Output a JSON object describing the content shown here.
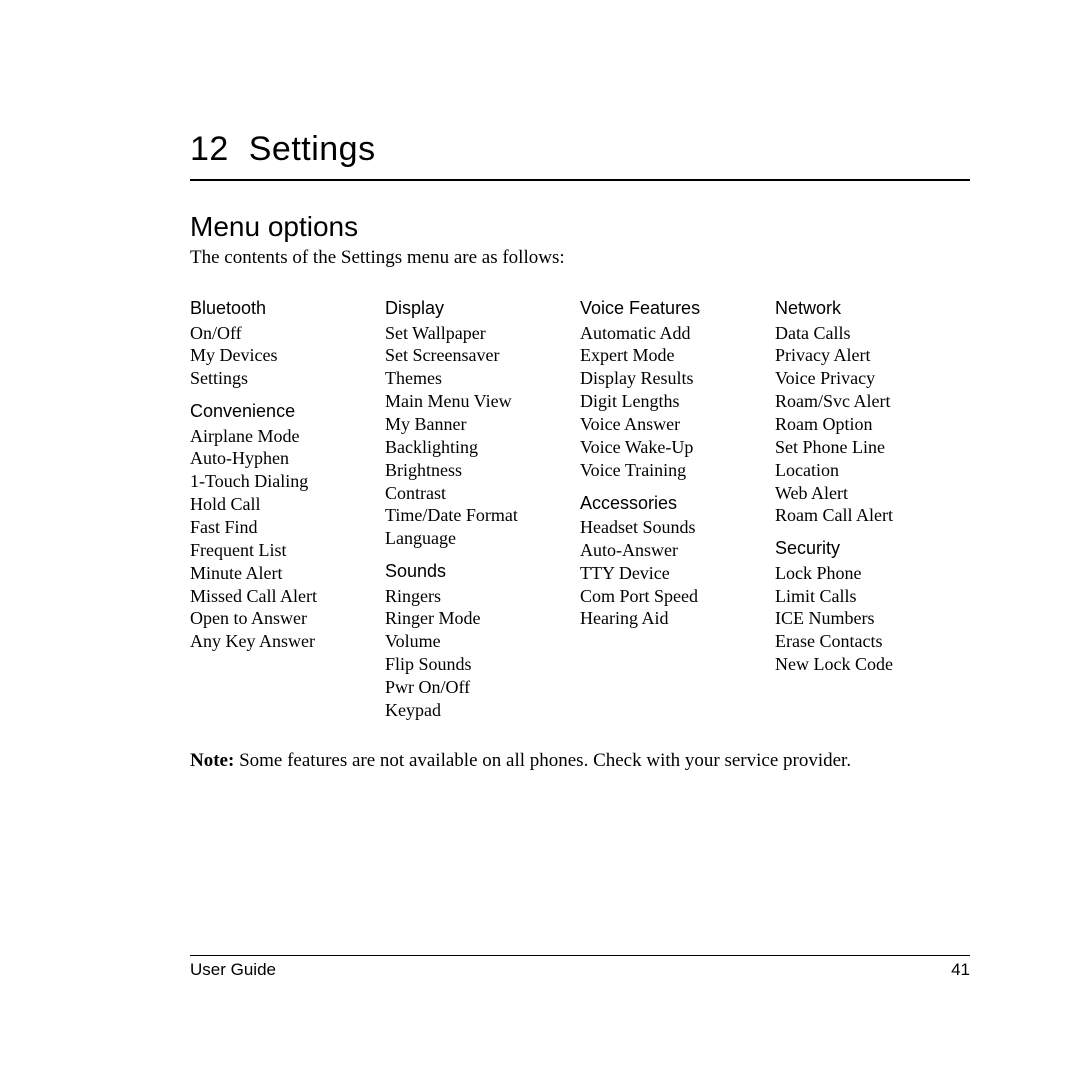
{
  "chapter": {
    "number": "12",
    "title": "Settings"
  },
  "section": {
    "heading": "Menu options",
    "intro": "The contents of the Settings menu are as follows:"
  },
  "columns": [
    {
      "groups": [
        {
          "heading": "Bluetooth",
          "items": [
            "On/Off",
            "My Devices",
            "Settings"
          ]
        },
        {
          "heading": "Convenience",
          "items": [
            "Airplane Mode",
            "Auto-Hyphen",
            "1-Touch Dialing",
            "Hold Call",
            "Fast Find",
            "Frequent List",
            "Minute Alert",
            "Missed Call Alert",
            "Open to Answer",
            "Any Key Answer"
          ]
        }
      ]
    },
    {
      "groups": [
        {
          "heading": "Display",
          "items": [
            "Set Wallpaper",
            "Set Screensaver",
            "Themes",
            "Main Menu View",
            "My Banner",
            "Backlighting",
            "Brightness",
            "Contrast",
            "Time/Date Format",
            "Language"
          ]
        },
        {
          "heading": "Sounds",
          "items": [
            "Ringers",
            "Ringer Mode",
            "Volume",
            "Flip Sounds",
            "Pwr On/Off",
            "Keypad"
          ]
        }
      ]
    },
    {
      "groups": [
        {
          "heading": "Voice Features",
          "items": [
            "Automatic Add",
            "Expert Mode",
            "Display Results",
            "Digit Lengths",
            "Voice Answer",
            "Voice Wake-Up",
            "Voice Training"
          ]
        },
        {
          "heading": "Accessories",
          "items": [
            "Headset Sounds",
            "Auto-Answer",
            "TTY Device",
            "Com Port Speed",
            "Hearing Aid"
          ]
        }
      ]
    },
    {
      "groups": [
        {
          "heading": "Network",
          "items": [
            "Data Calls",
            "Privacy Alert",
            "Voice Privacy",
            "Roam/Svc Alert",
            "Roam Option",
            "Set Phone Line",
            "Location",
            "Web Alert",
            "Roam Call Alert"
          ]
        },
        {
          "heading": "Security",
          "items": [
            "Lock Phone",
            "Limit Calls",
            "ICE Numbers",
            "Erase Contacts",
            "New Lock Code"
          ]
        }
      ]
    }
  ],
  "note": {
    "label": "Note:",
    "text": "Some features are not available on all phones. Check with your service provider."
  },
  "footer": {
    "left": "User Guide",
    "right": "41"
  }
}
